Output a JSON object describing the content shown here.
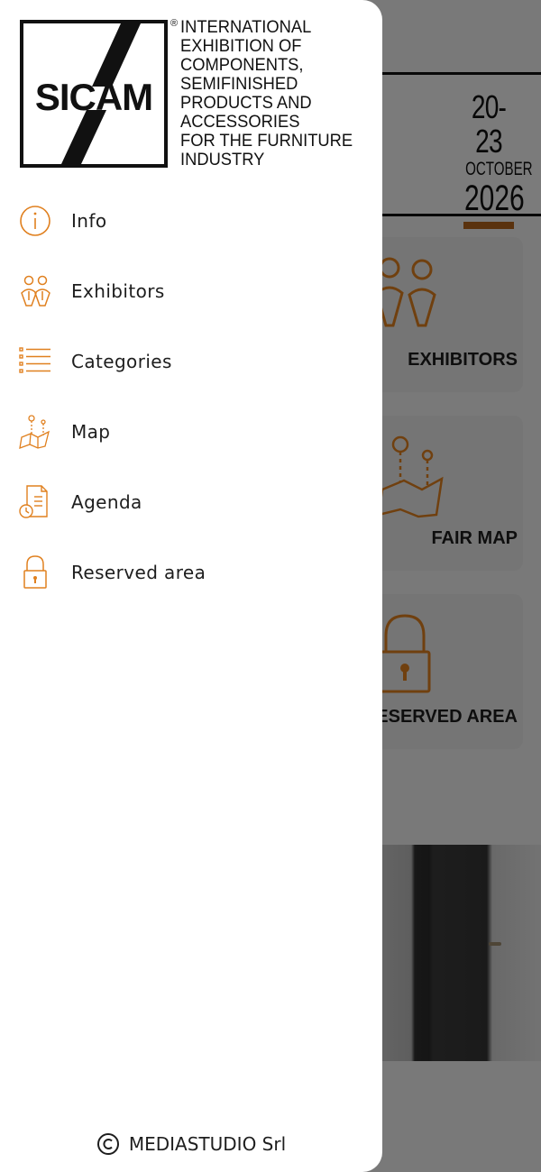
{
  "brand": {
    "logo_text": "SICAM",
    "registered_mark": "®",
    "tagline_lines": [
      "INTERNATIONAL",
      "EXHIBITION OF",
      "COMPONENTS,",
      "SEMIFINISHED",
      "PRODUCTS AND",
      "ACCESSORIES",
      "FOR THE FURNITURE",
      "INDUSTRY"
    ]
  },
  "event_dates": {
    "days": "20-23",
    "month": "OCTOBER",
    "year": "2026"
  },
  "menu": {
    "items": [
      {
        "label": "Info",
        "icon": "info-icon"
      },
      {
        "label": "Exhibitors",
        "icon": "exhibitors-icon"
      },
      {
        "label": "Categories",
        "icon": "list-icon"
      },
      {
        "label": "Map",
        "icon": "map-icon"
      },
      {
        "label": "Agenda",
        "icon": "agenda-icon"
      },
      {
        "label": "Reserved area",
        "icon": "lock-icon"
      }
    ]
  },
  "background_cards": {
    "exhibitors_label": "EXHIBITORS",
    "map_label": "FAIR MAP",
    "reserved_label": "RESERVED AREA"
  },
  "footer": {
    "copyright_symbol": "©",
    "company": "MEDIASTUDIO Srl"
  },
  "colors": {
    "accent": "#e0801f",
    "accent_dark": "#b5651d",
    "overlay": "rgba(0,0,0,0.5)",
    "text": "#1e1e1e"
  }
}
